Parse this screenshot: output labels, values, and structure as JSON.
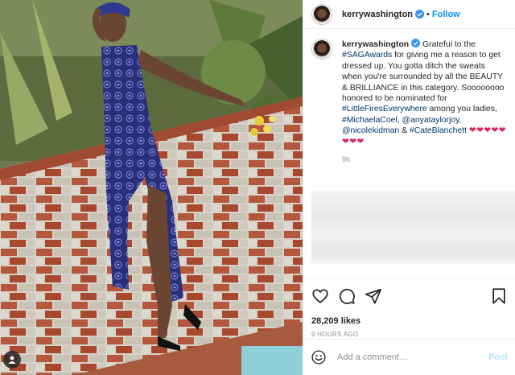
{
  "header": {
    "username": "kerrywashington",
    "separator": "•",
    "follow_label": "Follow"
  },
  "caption": {
    "username": "kerrywashington",
    "text_1": " Grateful to the ",
    "tag_1": "#SAGAwards",
    "text_2": " for giving me a reason to get dressed up. You gotta ditch the sweats when you're surrounded by all the BEAUTY & BRILLIANCE in this category. Soooooooo honored to be nominated for ",
    "tag_2": "#LittleFiresEverywhere",
    "text_3": " among you ladies, ",
    "tag_3": "#MichaelaCoel",
    "text_4": ", ",
    "tag_4": "@anyataylorjoy",
    "text_5": ", ",
    "tag_5": "@nicolekidman",
    "text_6": " & ",
    "tag_6": "#CateBlanchett",
    "text_7": " ",
    "hearts": "❤❤❤❤❤❤❤❤",
    "time": "9h"
  },
  "actions": {
    "likes": "28,209 likes",
    "posted_ago": "9 HOURS AGO"
  },
  "comment": {
    "placeholder": "Add a comment…",
    "post_label": "Post"
  },
  "icons": {
    "verified": "verified-badge-icon",
    "like": "heart-icon",
    "comment": "comment-bubble-icon",
    "share": "paper-plane-icon",
    "save": "bookmark-icon",
    "emoji": "smiley-icon",
    "tagged_user": "user-tag-icon"
  },
  "colors": {
    "link": "#00376b",
    "follow": "#0095f6",
    "verified": "#3897f0",
    "hearts": "#e0245e",
    "post_disabled": "#b2dffc"
  }
}
